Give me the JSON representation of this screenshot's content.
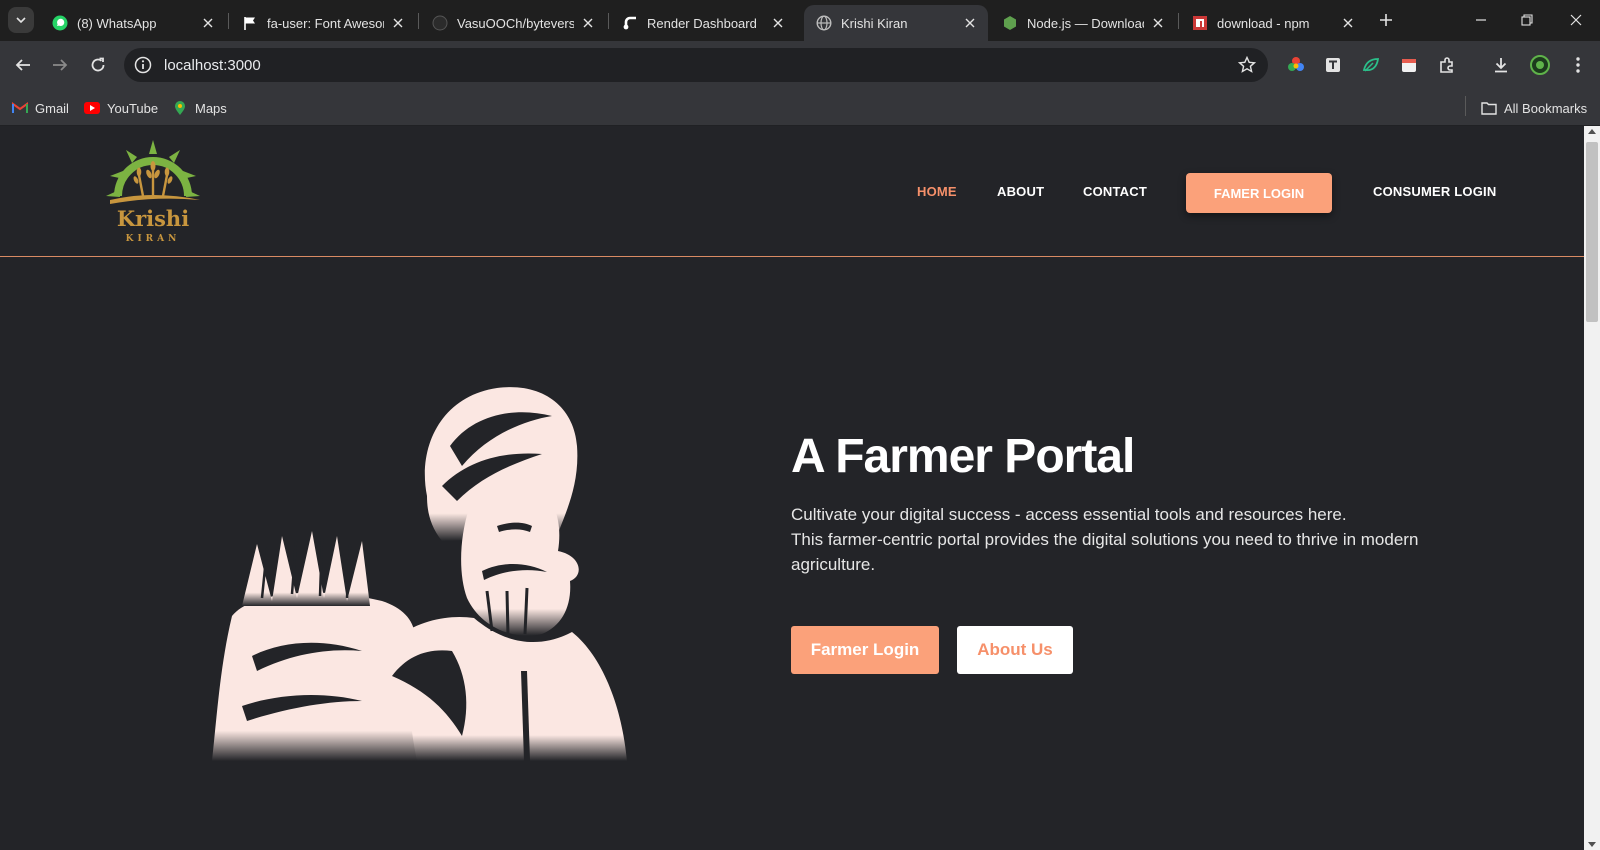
{
  "browser": {
    "tabs": [
      {
        "title": "(8) WhatsApp",
        "icon": "whatsapp-icon"
      },
      {
        "title": "fa-user: Font Awesome",
        "icon": "flag-icon"
      },
      {
        "title": "VasuOOCh/byteverse",
        "icon": "github-icon"
      },
      {
        "title": "Render Dashboard",
        "icon": "render-icon"
      },
      {
        "title": "Krishi Kiran",
        "icon": "globe-icon"
      },
      {
        "title": "Node.js — Download",
        "icon": "nodejs-icon"
      },
      {
        "title": "download - npm",
        "icon": "npm-icon"
      }
    ],
    "active_tab": 4,
    "url": "localhost:3000",
    "bookmarks": [
      {
        "label": "Gmail",
        "icon": "gmail-icon"
      },
      {
        "label": "YouTube",
        "icon": "youtube-icon"
      },
      {
        "label": "Maps",
        "icon": "maps-icon"
      }
    ],
    "all_bookmarks": "All Bookmarks"
  },
  "site": {
    "logo": {
      "name": "Krishi",
      "tagline": "KIRAN"
    },
    "nav": {
      "home": "HOME",
      "about": "ABOUT",
      "contact": "CONTACT",
      "farmer_login": "FAMER LOGIN",
      "consumer_login": "CONSUMER LOGIN"
    },
    "hero": {
      "title": "A Farmer Portal",
      "line1": "Cultivate your digital success - access essential tools and resources here.",
      "line2": "This farmer-centric portal provides the digital solutions you need to thrive in modern agriculture.",
      "primary_button": "Farmer Login",
      "secondary_button": "About Us"
    }
  },
  "colors": {
    "accent": "#fba17a",
    "accent_text": "#f6906a",
    "page_bg": "#232428",
    "logo_gold": "#c8963e",
    "logo_green": "#7cb342"
  }
}
